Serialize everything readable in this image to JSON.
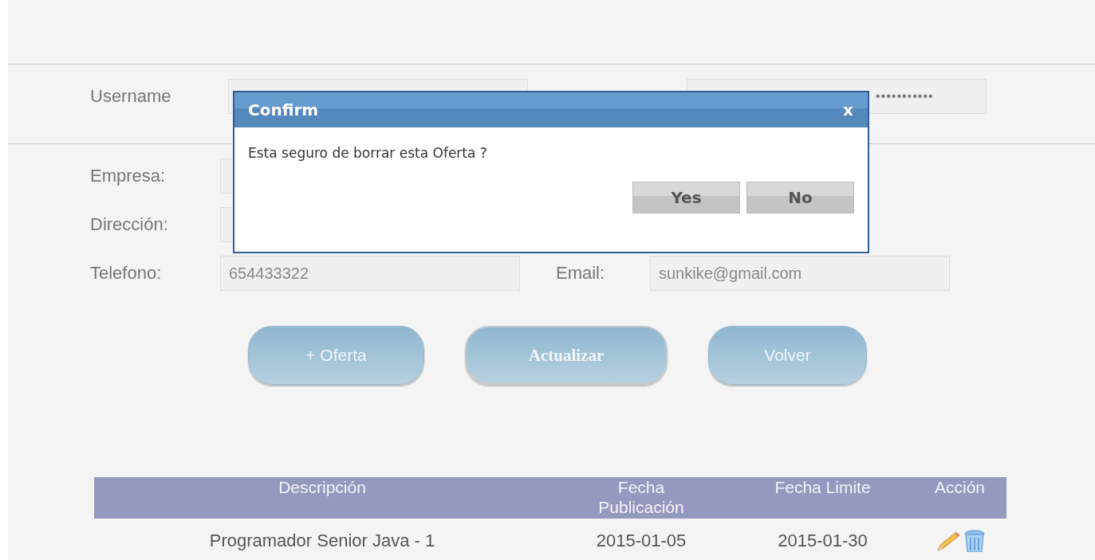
{
  "login": {
    "username_label": "Username",
    "password_value": "•••••••••••"
  },
  "form": {
    "rows": [
      {
        "fields": [
          {
            "label": "Empresa:"
          }
        ]
      },
      {
        "fields": [
          {
            "label": "Dirección:"
          }
        ]
      },
      {
        "fields": [
          {
            "label": "Telefono:",
            "value": "654433322"
          },
          {
            "label": "Email:",
            "value": "sunkike@gmail.com"
          }
        ]
      }
    ]
  },
  "buttons": [
    {
      "label": "+ Oferta",
      "focused": false
    },
    {
      "label": "Actualizar",
      "focused": true
    },
    {
      "label": "Volver",
      "focused": false
    }
  ],
  "table": {
    "columns": [
      "Descripción",
      "Fecha Publicación",
      "Fecha Limite",
      "Acción"
    ],
    "rows": [
      {
        "cells": [
          "Programador Senior Java - 1",
          "2015-01-05",
          "2015-01-30"
        ]
      }
    ]
  },
  "dialog": {
    "title": "Confirm",
    "close": "x",
    "message": "Esta seguro de borrar esta Oferta ?",
    "buttons": [
      "Yes",
      "No"
    ]
  }
}
